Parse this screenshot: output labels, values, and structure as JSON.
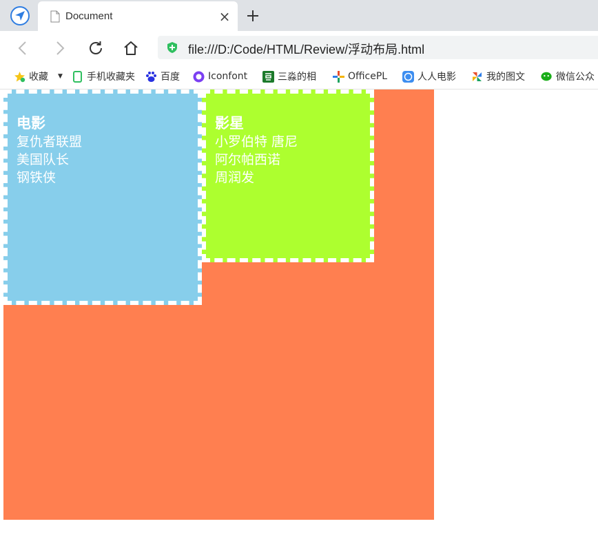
{
  "browser": {
    "tab": {
      "title": "Document",
      "close_symbol": "×"
    },
    "new_tab_symbol": "+",
    "address_bar": {
      "url": "file:///D:/Code/HTML/Review/浮动布局.html"
    }
  },
  "bookmarks": [
    {
      "label": "收藏",
      "icon": "star-plus-icon"
    },
    {
      "label": "手机收藏夹",
      "icon": "mobile-icon"
    },
    {
      "label": "百度",
      "icon": "baidu-paw-icon"
    },
    {
      "label": "Iconfont",
      "icon": "iconfont-logo-icon"
    },
    {
      "label": "三淼的相",
      "icon": "douban-icon"
    },
    {
      "label": "OfficePL",
      "icon": "officeplus-icon"
    },
    {
      "label": "人人电影",
      "icon": "rr-icon"
    },
    {
      "label": "我的图文",
      "icon": "pinwheel-icon"
    },
    {
      "label": "微信公众",
      "icon": "wechat-icon"
    }
  ],
  "page": {
    "container_color": "#ff7f50",
    "movies": {
      "heading": "电影",
      "items": [
        "复仇者联盟",
        "美国队长",
        "钢铁侠"
      ],
      "color": "#87ceeb"
    },
    "stars": {
      "heading": "影星",
      "items": [
        "小罗伯特 唐尼",
        "阿尔帕西诺",
        "周润发"
      ],
      "color": "#adff2f"
    }
  }
}
